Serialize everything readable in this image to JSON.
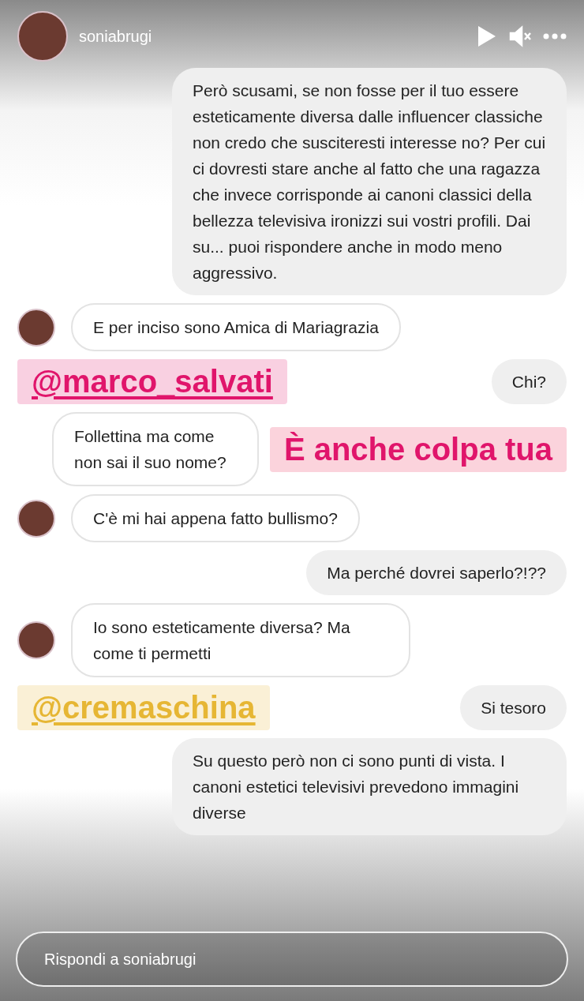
{
  "header": {
    "username": "soniabrugi"
  },
  "rows": [
    {
      "items": [
        {
          "kind": "sent",
          "text": "Però scusami, se non fosse per il tuo essere esteticamente diversa dalle influencer classiche non credo che susciteresti interesse no? Per cui ci dovresti stare anche al fatto che una ragazza che invece corrisponde ai canoni classici della bellezza televisiva ironizzi sui vostri profili. Dai su... puoi rispondere anche in modo meno aggressivo."
        }
      ]
    },
    {
      "items": [
        {
          "kind": "received",
          "avatar": true,
          "text": "E per inciso sono Amica di Mariagrazia"
        }
      ]
    },
    {
      "items": [
        {
          "kind": "mention",
          "color": "#e0156b",
          "text": "@marco_salvati"
        },
        {
          "kind": "sent",
          "text": "Chi?"
        }
      ]
    },
    {
      "items": [
        {
          "kind": "received",
          "avatar": false,
          "text": "Follettina ma come non sai il suo nome?"
        },
        {
          "kind": "sticker",
          "color": "#e0156b",
          "text": "È anche colpa tua"
        }
      ]
    },
    {
      "items": [
        {
          "kind": "received",
          "avatar": true,
          "text": "C'è mi hai appena fatto bullismo?"
        }
      ]
    },
    {
      "items": [
        {
          "kind": "sent",
          "text": "Ma perché dovrei saperlo?!??"
        }
      ]
    },
    {
      "items": [
        {
          "kind": "received",
          "avatar": true,
          "text": "Io sono esteticamente diversa? Ma come ti permetti"
        }
      ]
    },
    {
      "items": [
        {
          "kind": "mention",
          "color": "#e6b634",
          "text": "@cremaschina"
        },
        {
          "kind": "sent",
          "text": "Si tesoro"
        }
      ]
    },
    {
      "items": [
        {
          "kind": "sent",
          "text": "Su questo però non ci sono punti di vista. I canoni estetici televisivi prevedono immagini diverse"
        }
      ]
    }
  ],
  "reply": {
    "placeholder": "Rispondi a soniabrugi"
  }
}
